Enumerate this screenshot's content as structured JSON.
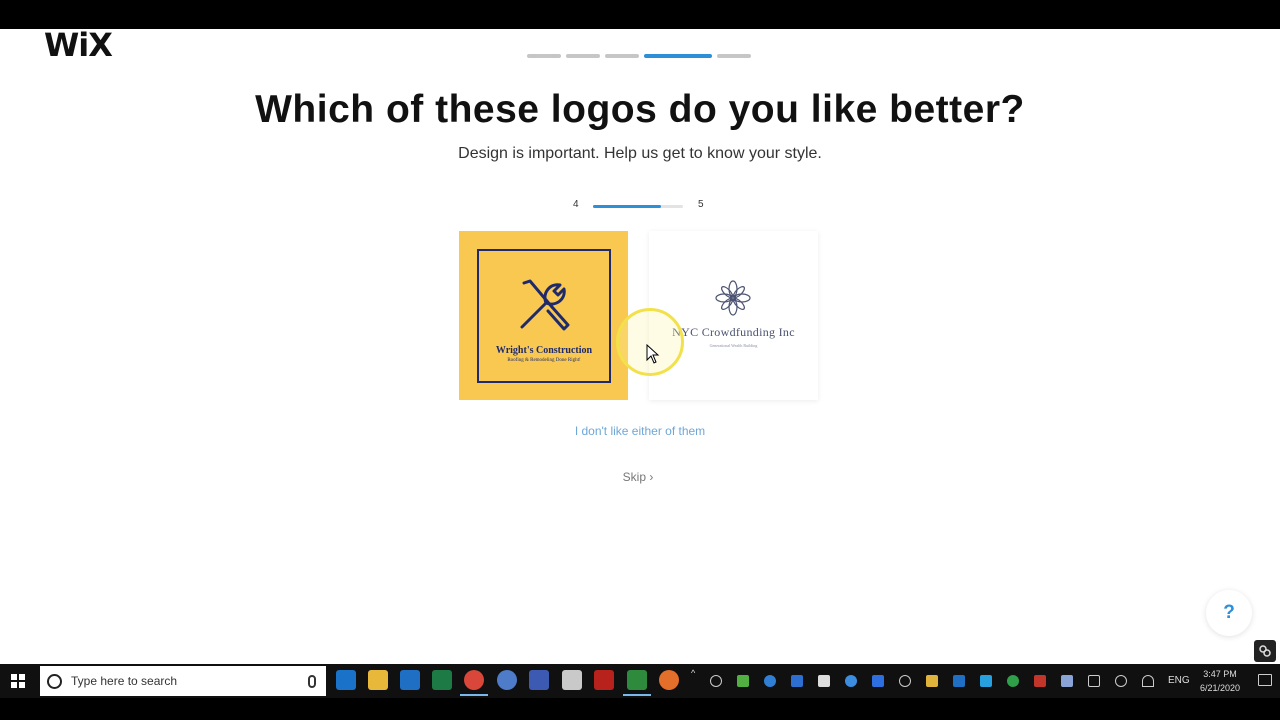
{
  "brand": {
    "logo_text": "WiX"
  },
  "steps": {
    "count": 5,
    "active_index": 3
  },
  "header": {
    "title": "Which of these logos do you like better?",
    "subtitle": "Design is important. Help us get to know your style."
  },
  "round": {
    "current": "4",
    "total": "5",
    "progress_fraction": 0.75
  },
  "options": {
    "left": {
      "name": "Wright's Construction",
      "tagline": "Roofing & Remodeling Done Right!",
      "bg_color": "#f9c850",
      "ink_color": "#1e2a6b",
      "icon": "wrench-screwdriver-icon"
    },
    "right": {
      "name": "NYC Crowdfunding Inc",
      "tagline": "Generational Wealth Building",
      "bg_color": "#ffffff",
      "ink_color": "#4a5270",
      "icon": "flower-icon"
    }
  },
  "actions": {
    "dislike_label": "I don't like either of them",
    "skip_label": "Skip",
    "skip_icon": "chevron-right-icon",
    "help_label": "?"
  },
  "taskbar": {
    "search_placeholder": "Type here to search",
    "language": "ENG",
    "time": "3:47 PM",
    "date": "6/21/2020"
  },
  "colors": {
    "accent": "#2d8fd7",
    "link": "#6fa6d6",
    "cursor_highlight": "#f2e14a"
  }
}
